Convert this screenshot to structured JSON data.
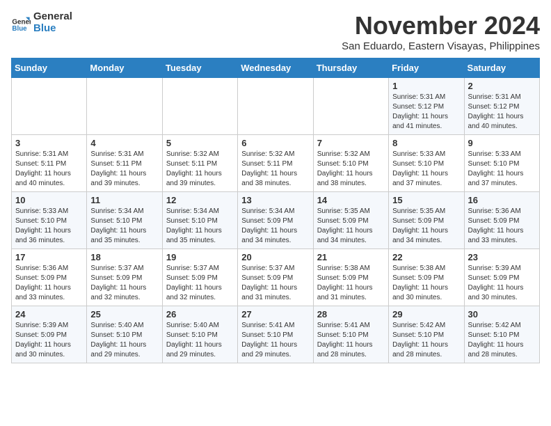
{
  "logo": {
    "line1": "General",
    "line2": "Blue"
  },
  "title": "November 2024",
  "location": "San Eduardo, Eastern Visayas, Philippines",
  "days_of_week": [
    "Sunday",
    "Monday",
    "Tuesday",
    "Wednesday",
    "Thursday",
    "Friday",
    "Saturday"
  ],
  "weeks": [
    [
      {
        "day": "",
        "sunrise": "",
        "sunset": "",
        "daylight": ""
      },
      {
        "day": "",
        "sunrise": "",
        "sunset": "",
        "daylight": ""
      },
      {
        "day": "",
        "sunrise": "",
        "sunset": "",
        "daylight": ""
      },
      {
        "day": "",
        "sunrise": "",
        "sunset": "",
        "daylight": ""
      },
      {
        "day": "",
        "sunrise": "",
        "sunset": "",
        "daylight": ""
      },
      {
        "day": "1",
        "sunrise": "Sunrise: 5:31 AM",
        "sunset": "Sunset: 5:12 PM",
        "daylight": "Daylight: 11 hours and 41 minutes."
      },
      {
        "day": "2",
        "sunrise": "Sunrise: 5:31 AM",
        "sunset": "Sunset: 5:12 PM",
        "daylight": "Daylight: 11 hours and 40 minutes."
      }
    ],
    [
      {
        "day": "3",
        "sunrise": "Sunrise: 5:31 AM",
        "sunset": "Sunset: 5:11 PM",
        "daylight": "Daylight: 11 hours and 40 minutes."
      },
      {
        "day": "4",
        "sunrise": "Sunrise: 5:31 AM",
        "sunset": "Sunset: 5:11 PM",
        "daylight": "Daylight: 11 hours and 39 minutes."
      },
      {
        "day": "5",
        "sunrise": "Sunrise: 5:32 AM",
        "sunset": "Sunset: 5:11 PM",
        "daylight": "Daylight: 11 hours and 39 minutes."
      },
      {
        "day": "6",
        "sunrise": "Sunrise: 5:32 AM",
        "sunset": "Sunset: 5:11 PM",
        "daylight": "Daylight: 11 hours and 38 minutes."
      },
      {
        "day": "7",
        "sunrise": "Sunrise: 5:32 AM",
        "sunset": "Sunset: 5:10 PM",
        "daylight": "Daylight: 11 hours and 38 minutes."
      },
      {
        "day": "8",
        "sunrise": "Sunrise: 5:33 AM",
        "sunset": "Sunset: 5:10 PM",
        "daylight": "Daylight: 11 hours and 37 minutes."
      },
      {
        "day": "9",
        "sunrise": "Sunrise: 5:33 AM",
        "sunset": "Sunset: 5:10 PM",
        "daylight": "Daylight: 11 hours and 37 minutes."
      }
    ],
    [
      {
        "day": "10",
        "sunrise": "Sunrise: 5:33 AM",
        "sunset": "Sunset: 5:10 PM",
        "daylight": "Daylight: 11 hours and 36 minutes."
      },
      {
        "day": "11",
        "sunrise": "Sunrise: 5:34 AM",
        "sunset": "Sunset: 5:10 PM",
        "daylight": "Daylight: 11 hours and 35 minutes."
      },
      {
        "day": "12",
        "sunrise": "Sunrise: 5:34 AM",
        "sunset": "Sunset: 5:10 PM",
        "daylight": "Daylight: 11 hours and 35 minutes."
      },
      {
        "day": "13",
        "sunrise": "Sunrise: 5:34 AM",
        "sunset": "Sunset: 5:09 PM",
        "daylight": "Daylight: 11 hours and 34 minutes."
      },
      {
        "day": "14",
        "sunrise": "Sunrise: 5:35 AM",
        "sunset": "Sunset: 5:09 PM",
        "daylight": "Daylight: 11 hours and 34 minutes."
      },
      {
        "day": "15",
        "sunrise": "Sunrise: 5:35 AM",
        "sunset": "Sunset: 5:09 PM",
        "daylight": "Daylight: 11 hours and 34 minutes."
      },
      {
        "day": "16",
        "sunrise": "Sunrise: 5:36 AM",
        "sunset": "Sunset: 5:09 PM",
        "daylight": "Daylight: 11 hours and 33 minutes."
      }
    ],
    [
      {
        "day": "17",
        "sunrise": "Sunrise: 5:36 AM",
        "sunset": "Sunset: 5:09 PM",
        "daylight": "Daylight: 11 hours and 33 minutes."
      },
      {
        "day": "18",
        "sunrise": "Sunrise: 5:37 AM",
        "sunset": "Sunset: 5:09 PM",
        "daylight": "Daylight: 11 hours and 32 minutes."
      },
      {
        "day": "19",
        "sunrise": "Sunrise: 5:37 AM",
        "sunset": "Sunset: 5:09 PM",
        "daylight": "Daylight: 11 hours and 32 minutes."
      },
      {
        "day": "20",
        "sunrise": "Sunrise: 5:37 AM",
        "sunset": "Sunset: 5:09 PM",
        "daylight": "Daylight: 11 hours and 31 minutes."
      },
      {
        "day": "21",
        "sunrise": "Sunrise: 5:38 AM",
        "sunset": "Sunset: 5:09 PM",
        "daylight": "Daylight: 11 hours and 31 minutes."
      },
      {
        "day": "22",
        "sunrise": "Sunrise: 5:38 AM",
        "sunset": "Sunset: 5:09 PM",
        "daylight": "Daylight: 11 hours and 30 minutes."
      },
      {
        "day": "23",
        "sunrise": "Sunrise: 5:39 AM",
        "sunset": "Sunset: 5:09 PM",
        "daylight": "Daylight: 11 hours and 30 minutes."
      }
    ],
    [
      {
        "day": "24",
        "sunrise": "Sunrise: 5:39 AM",
        "sunset": "Sunset: 5:09 PM",
        "daylight": "Daylight: 11 hours and 30 minutes."
      },
      {
        "day": "25",
        "sunrise": "Sunrise: 5:40 AM",
        "sunset": "Sunset: 5:10 PM",
        "daylight": "Daylight: 11 hours and 29 minutes."
      },
      {
        "day": "26",
        "sunrise": "Sunrise: 5:40 AM",
        "sunset": "Sunset: 5:10 PM",
        "daylight": "Daylight: 11 hours and 29 minutes."
      },
      {
        "day": "27",
        "sunrise": "Sunrise: 5:41 AM",
        "sunset": "Sunset: 5:10 PM",
        "daylight": "Daylight: 11 hours and 29 minutes."
      },
      {
        "day": "28",
        "sunrise": "Sunrise: 5:41 AM",
        "sunset": "Sunset: 5:10 PM",
        "daylight": "Daylight: 11 hours and 28 minutes."
      },
      {
        "day": "29",
        "sunrise": "Sunrise: 5:42 AM",
        "sunset": "Sunset: 5:10 PM",
        "daylight": "Daylight: 11 hours and 28 minutes."
      },
      {
        "day": "30",
        "sunrise": "Sunrise: 5:42 AM",
        "sunset": "Sunset: 5:10 PM",
        "daylight": "Daylight: 11 hours and 28 minutes."
      }
    ]
  ]
}
